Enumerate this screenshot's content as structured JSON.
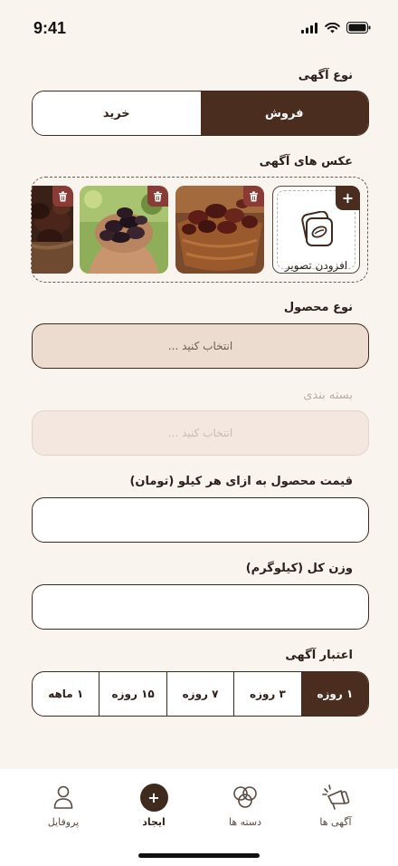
{
  "status": {
    "time": "9:41"
  },
  "ad_type": {
    "label": "نوع آگهی",
    "options": [
      "فروش",
      "خرید"
    ]
  },
  "photos": {
    "label": "عکس های آگهی",
    "add_label": "افزودن تصویر",
    "add_symbol": "+"
  },
  "product_type": {
    "label": "نوع محصول",
    "placeholder": "انتخاب کنید ..."
  },
  "packaging": {
    "label": "بسته بندی",
    "placeholder": "انتخاب کنید ..."
  },
  "price": {
    "label": "قیمت محصول به ازای هر کیلو (تومان)",
    "value": ""
  },
  "weight": {
    "label": "وزن کل (کیلوگرم)",
    "value": ""
  },
  "validity": {
    "label": "اعتبار آگهی",
    "options": [
      "۱ روزه",
      "۳ روزه",
      "۷ روزه",
      "۱۵ روزه",
      "۱ ماهه"
    ]
  },
  "nav": {
    "items": [
      "آگهی ها",
      "دسته ها",
      "ایجاد",
      "پروفایل"
    ],
    "create_symbol": "+"
  },
  "colors": {
    "primary": "#4b2d1f",
    "background": "#faf4ee",
    "select_fill": "#ecdcd0",
    "trash": "#8a3b36"
  }
}
